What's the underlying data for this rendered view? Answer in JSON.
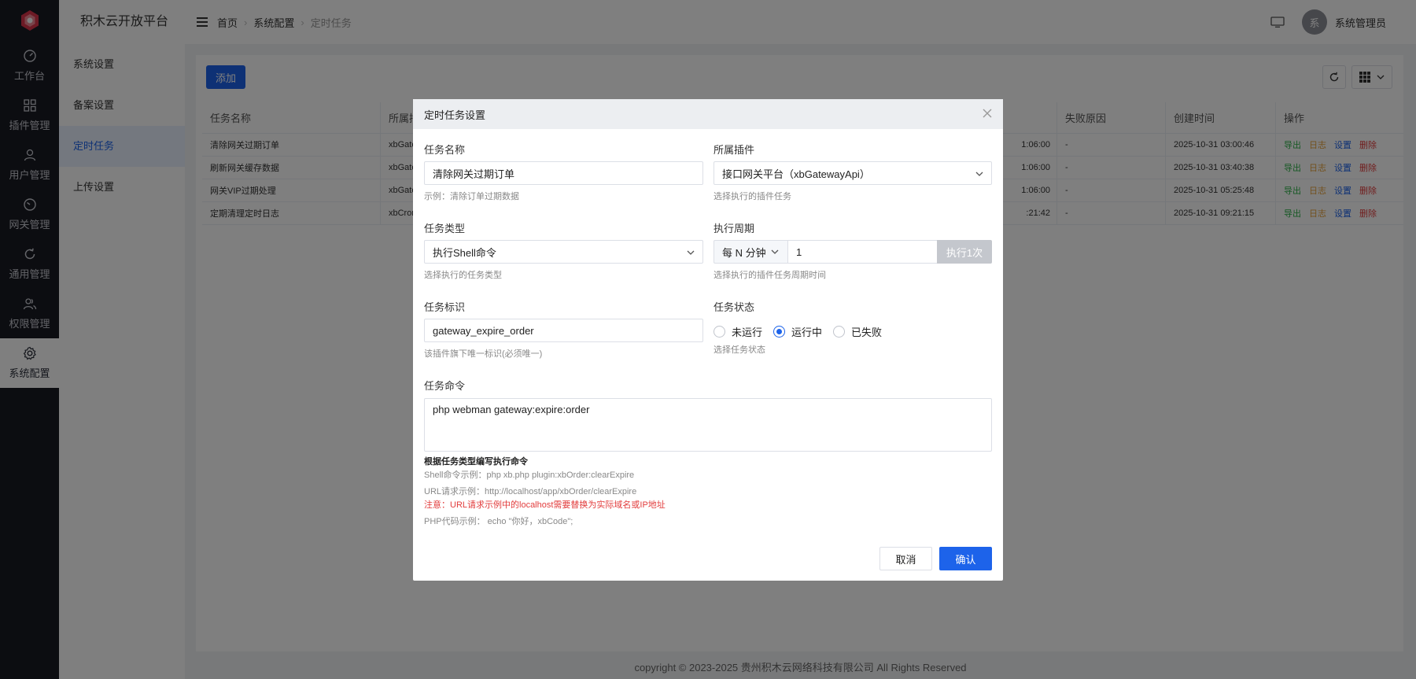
{
  "app": {
    "title": "积木云开放平台"
  },
  "rail": {
    "items": [
      {
        "label": "工作台",
        "icon": "dashboard-icon"
      },
      {
        "label": "插件管理",
        "icon": "grid-icon"
      },
      {
        "label": "用户管理",
        "icon": "user-icon"
      },
      {
        "label": "网关管理",
        "icon": "gauge-icon"
      },
      {
        "label": "通用管理",
        "icon": "refresh-icon"
      },
      {
        "label": "权限管理",
        "icon": "users-icon"
      },
      {
        "label": "系统配置",
        "icon": "gear-icon",
        "active": true
      }
    ]
  },
  "subnav": {
    "items": [
      {
        "label": "系统设置"
      },
      {
        "label": "备案设置"
      },
      {
        "label": "定时任务",
        "active": true
      },
      {
        "label": "上传设置"
      }
    ]
  },
  "header": {
    "breadcrumb": [
      "首页",
      "系统配置",
      "定时任务"
    ],
    "username": "系统管理员",
    "avatar_text": "系"
  },
  "toolbar": {
    "add_label": "添加"
  },
  "table": {
    "headers": [
      "任务名称",
      "所属插",
      "失败原因",
      "创建时间",
      "操作"
    ],
    "rows": [
      {
        "name": "清除网关过期订单",
        "plugin": "xbGatew",
        "time_frag": "1:06:00",
        "fail": "-",
        "created": "2025-10-31 03:00:46"
      },
      {
        "name": "刷新网关缓存数据",
        "plugin": "xbGatew",
        "time_frag": "1:06:00",
        "fail": "-",
        "created": "2025-10-31 03:40:38"
      },
      {
        "name": "网关VIP过期处理",
        "plugin": "xbGatew",
        "time_frag": "1:06:00",
        "fail": "-",
        "created": "2025-10-31 05:25:48"
      },
      {
        "name": "定期清理定时日志",
        "plugin": "xbCront",
        "time_frag": ":21:42",
        "fail": "-",
        "created": "2025-10-31 09:21:15"
      }
    ],
    "actions": [
      "导出",
      "日志",
      "设置",
      "删除"
    ]
  },
  "footer": {
    "text": "copyright © 2023-2025 贵州积木云网络科技有限公司 All Rights Reserved"
  },
  "modal": {
    "title": "定时任务设置",
    "name": {
      "label": "任务名称",
      "value": "清除网关过期订单",
      "hint": "示例：清除订单过期数据"
    },
    "plugin": {
      "label": "所属插件",
      "value": "接口网关平台（xbGatewayApi）",
      "hint": "选择执行的插件任务"
    },
    "type": {
      "label": "任务类型",
      "value": "执行Shell命令",
      "hint": "选择执行的任务类型"
    },
    "cycle": {
      "label": "执行周期",
      "unit": "每 N 分钟",
      "value": "1",
      "run_label": "执行1次",
      "hint": "选择执行的插件任务周期时间"
    },
    "key": {
      "label": "任务标识",
      "value": "gateway_expire_order",
      "hint": "该插件旗下唯一标识(必须唯一)"
    },
    "status": {
      "label": "任务状态",
      "options": [
        "未运行",
        "运行中",
        "已失败"
      ],
      "selected": "运行中",
      "hint": "选择任务状态"
    },
    "command": {
      "label": "任务命令",
      "value": "php webman gateway:expire:order"
    },
    "notes": {
      "title": "根据任务类型编写执行命令",
      "shell": "Shell命令示例：php xb.php plugin:xbOrder:clearExpire",
      "url": "URL请求示例：http://localhost/app/xbOrder/clearExpire",
      "warning": "注意：URL请求示例中的localhost需要替换为实际域名或IP地址",
      "php": "PHP代码示例： echo \"你好，xbCode\";"
    },
    "cancel_label": "取消",
    "ok_label": "确认"
  },
  "colors": {
    "accent": "#1d63ea",
    "rail_bg": "#191a23",
    "danger": "#e23c3c",
    "success": "#2fb34a",
    "warning": "#e6a23c"
  }
}
